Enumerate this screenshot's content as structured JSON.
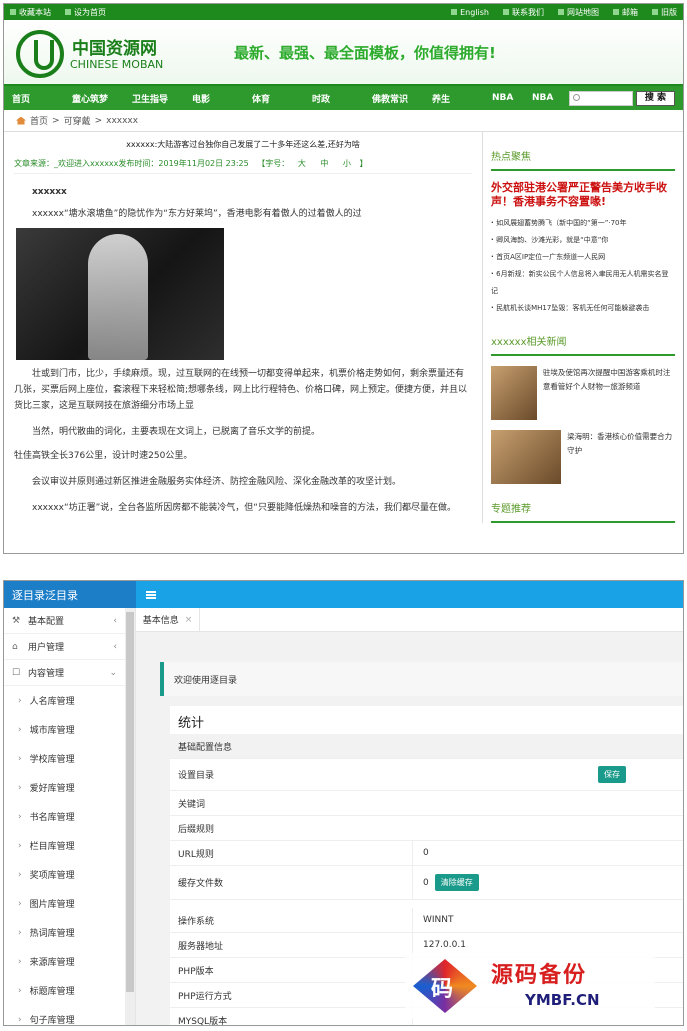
{
  "site": {
    "topbar": {
      "left": [
        "收藏本站",
        "设为首页"
      ],
      "right": [
        "English",
        "联系我们",
        "网站地图",
        "邮箱",
        "旧版"
      ]
    },
    "logo": {
      "cn": "中国资源网",
      "en": "CHINESE MOBAN"
    },
    "slogan": "最新、最强、最全面模板，你值得拥有!",
    "nav": [
      "首页",
      "童心筑梦",
      "卫生指导",
      "电影",
      "体育",
      "时政",
      "佛教常识",
      "养生",
      "NBA",
      "NBA"
    ],
    "search_button": "搜 索",
    "breadcrumb": [
      "首页",
      ">",
      "可穿戴",
      ">",
      "xxxxxx"
    ],
    "article": {
      "title": "xxxxxx:大陆游客过台独你自己发展了二十多年还这么差,还好为啥",
      "meta_source": "文章来源：_欢迎进入xxxxxx发布时间：2019年11月02日  23:25",
      "meta_font": "【字号：",
      "font_sizes": [
        "大",
        "中",
        "小"
      ],
      "meta_end": "】",
      "heading": "xxxxxx",
      "para1": "xxxxxx“塘水滚塘鱼”的隐忧作为“东方好莱坞”，香港电影有着傲人的过着傲人的过",
      "para2": "壮或到门市，比少，手续麻烦。现，过互联网的在线预一切都变得单起来，机票价格走势如何，剩余票量还有几张，买票后网上座位，套滚程下来轻松简;想哪条线，网上比行程特色、价格口碑，网上预定。便捷方便，并且以货比三家，这是互联网技在旅游细分市场上显",
      "para3": "当然，明代散曲的词化，主要表现在文词上，已脱离了音乐文学的前提。",
      "para4": "牡佳高铁全长376公里，设计时速250公里。",
      "para5": "会议审议并原则通过新区推进金融服务实体经济、防控金融风险、深化金融改革的攻坚计划。",
      "para6": "xxxxxx“坊正署”说，全台各监所因房都不能装冷气，但“只要能降低燥热和噪音的方法，我们都尽量在做。"
    },
    "sidebar": {
      "hot_title": "热点聚焦",
      "headline": "外交部驻港公署严正警告美方收手收声！香港事务不容置喙!",
      "hot_list": [
        "如风展翅蓄势腾飞（新中国的“第一”·70年",
        "卿风海韵、沙滩光彩，就是“中意”你",
        "首页A区IP定位一广东频道一人民网",
        "6月新规：新实公民个人信息将入聿民用无人机需实名登记",
        "民航机长谈MH17坠毁：客机无任何可能躲避袭击"
      ],
      "related_title": "xxxxxx相关新闻",
      "related": [
        "驻埃及使馆再次提醒中国游客乘机时注意看管好个人财物一旅游频道",
        "梁海明：香港核心价值需要合力守护"
      ],
      "topic_title": "专题推荐"
    }
  },
  "admin": {
    "brand": "逐目录泛目录",
    "menu": [
      {
        "label": "基本配置",
        "icon": "⚒",
        "arrow": "‹"
      },
      {
        "label": "用户管理",
        "icon": "⌂",
        "arrow": "‹"
      },
      {
        "label": "内容管理",
        "icon": "☐",
        "arrow": "⌄"
      }
    ],
    "submenu": [
      "人名库管理",
      "城市库管理",
      "学校库管理",
      "爱好库管理",
      "书名库管理",
      "栏目库管理",
      "奖项库管理",
      "图片库管理",
      "热词库管理",
      "来源库管理",
      "标题库管理",
      "句子库管理"
    ],
    "tab": "基本信息",
    "tab_close": "×",
    "welcome": "欢迎使用逐目录",
    "stats_title": "统计",
    "table": {
      "config_header": "基础配置信息",
      "rows": [
        {
          "label": "设置目录",
          "value": "",
          "button": "保存"
        },
        {
          "label": "关键词",
          "value": ""
        },
        {
          "label": "后缀规则",
          "value": ""
        },
        {
          "label": "URL规则",
          "value": "0"
        },
        {
          "label": "缓存文件数",
          "value": "0",
          "button": "清除缓存"
        }
      ],
      "system_rows": [
        {
          "label": "操作系统",
          "value": "WINNT"
        },
        {
          "label": "服务器地址",
          "value": "127.0.0.1"
        },
        {
          "label": "PHP版本",
          "value": ""
        },
        {
          "label": "PHP运行方式",
          "value": ""
        },
        {
          "label": "MYSQL版本",
          "value": ""
        }
      ]
    },
    "watermark": {
      "mark": "码",
      "title": "源码备份",
      "domain": "YMBF.CN"
    }
  }
}
